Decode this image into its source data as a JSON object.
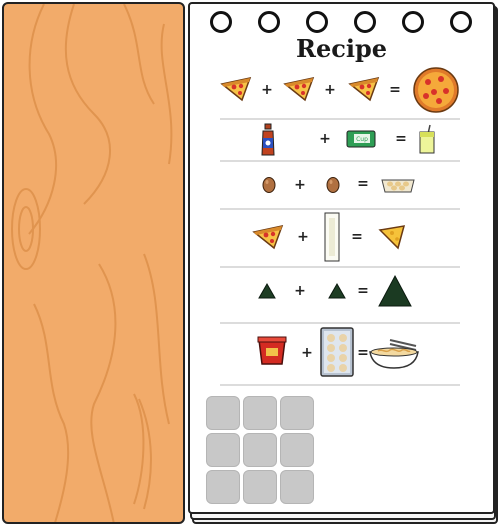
{
  "notebook": {
    "title": "Recipe"
  },
  "recipes": [
    {
      "inputs": [
        "pizza-slice-icon",
        "pizza-slice-icon",
        "pizza-slice-icon"
      ],
      "output": "whole-pizza-icon"
    },
    {
      "inputs": [
        "soda-bottle-icon",
        "green-can-icon"
      ],
      "output": "lemonade-cup-icon",
      "can_label": "Cup"
    },
    {
      "inputs": [
        "egg-icon",
        "egg-icon"
      ],
      "output": "egg-carton-icon"
    },
    {
      "inputs": [
        "pizza-slice-icon",
        "milk-glass-icon"
      ],
      "output": "cheese-slice-icon"
    },
    {
      "inputs": [
        "small-green-pile-icon",
        "small-green-pile-icon"
      ],
      "output": "large-green-pile-icon"
    },
    {
      "inputs": [
        "red-noodle-cup-icon",
        "dumpling-tray-icon"
      ],
      "output": "noodle-bowl-icon"
    }
  ],
  "operators": {
    "plus": "+",
    "equals": "="
  },
  "crafting_grid": {
    "rows": 3,
    "cols": 3,
    "state": "empty"
  },
  "colors": {
    "wood": "#f2ab6a",
    "wood_grain": "#e0944f",
    "slot": "#c8c8c8"
  }
}
